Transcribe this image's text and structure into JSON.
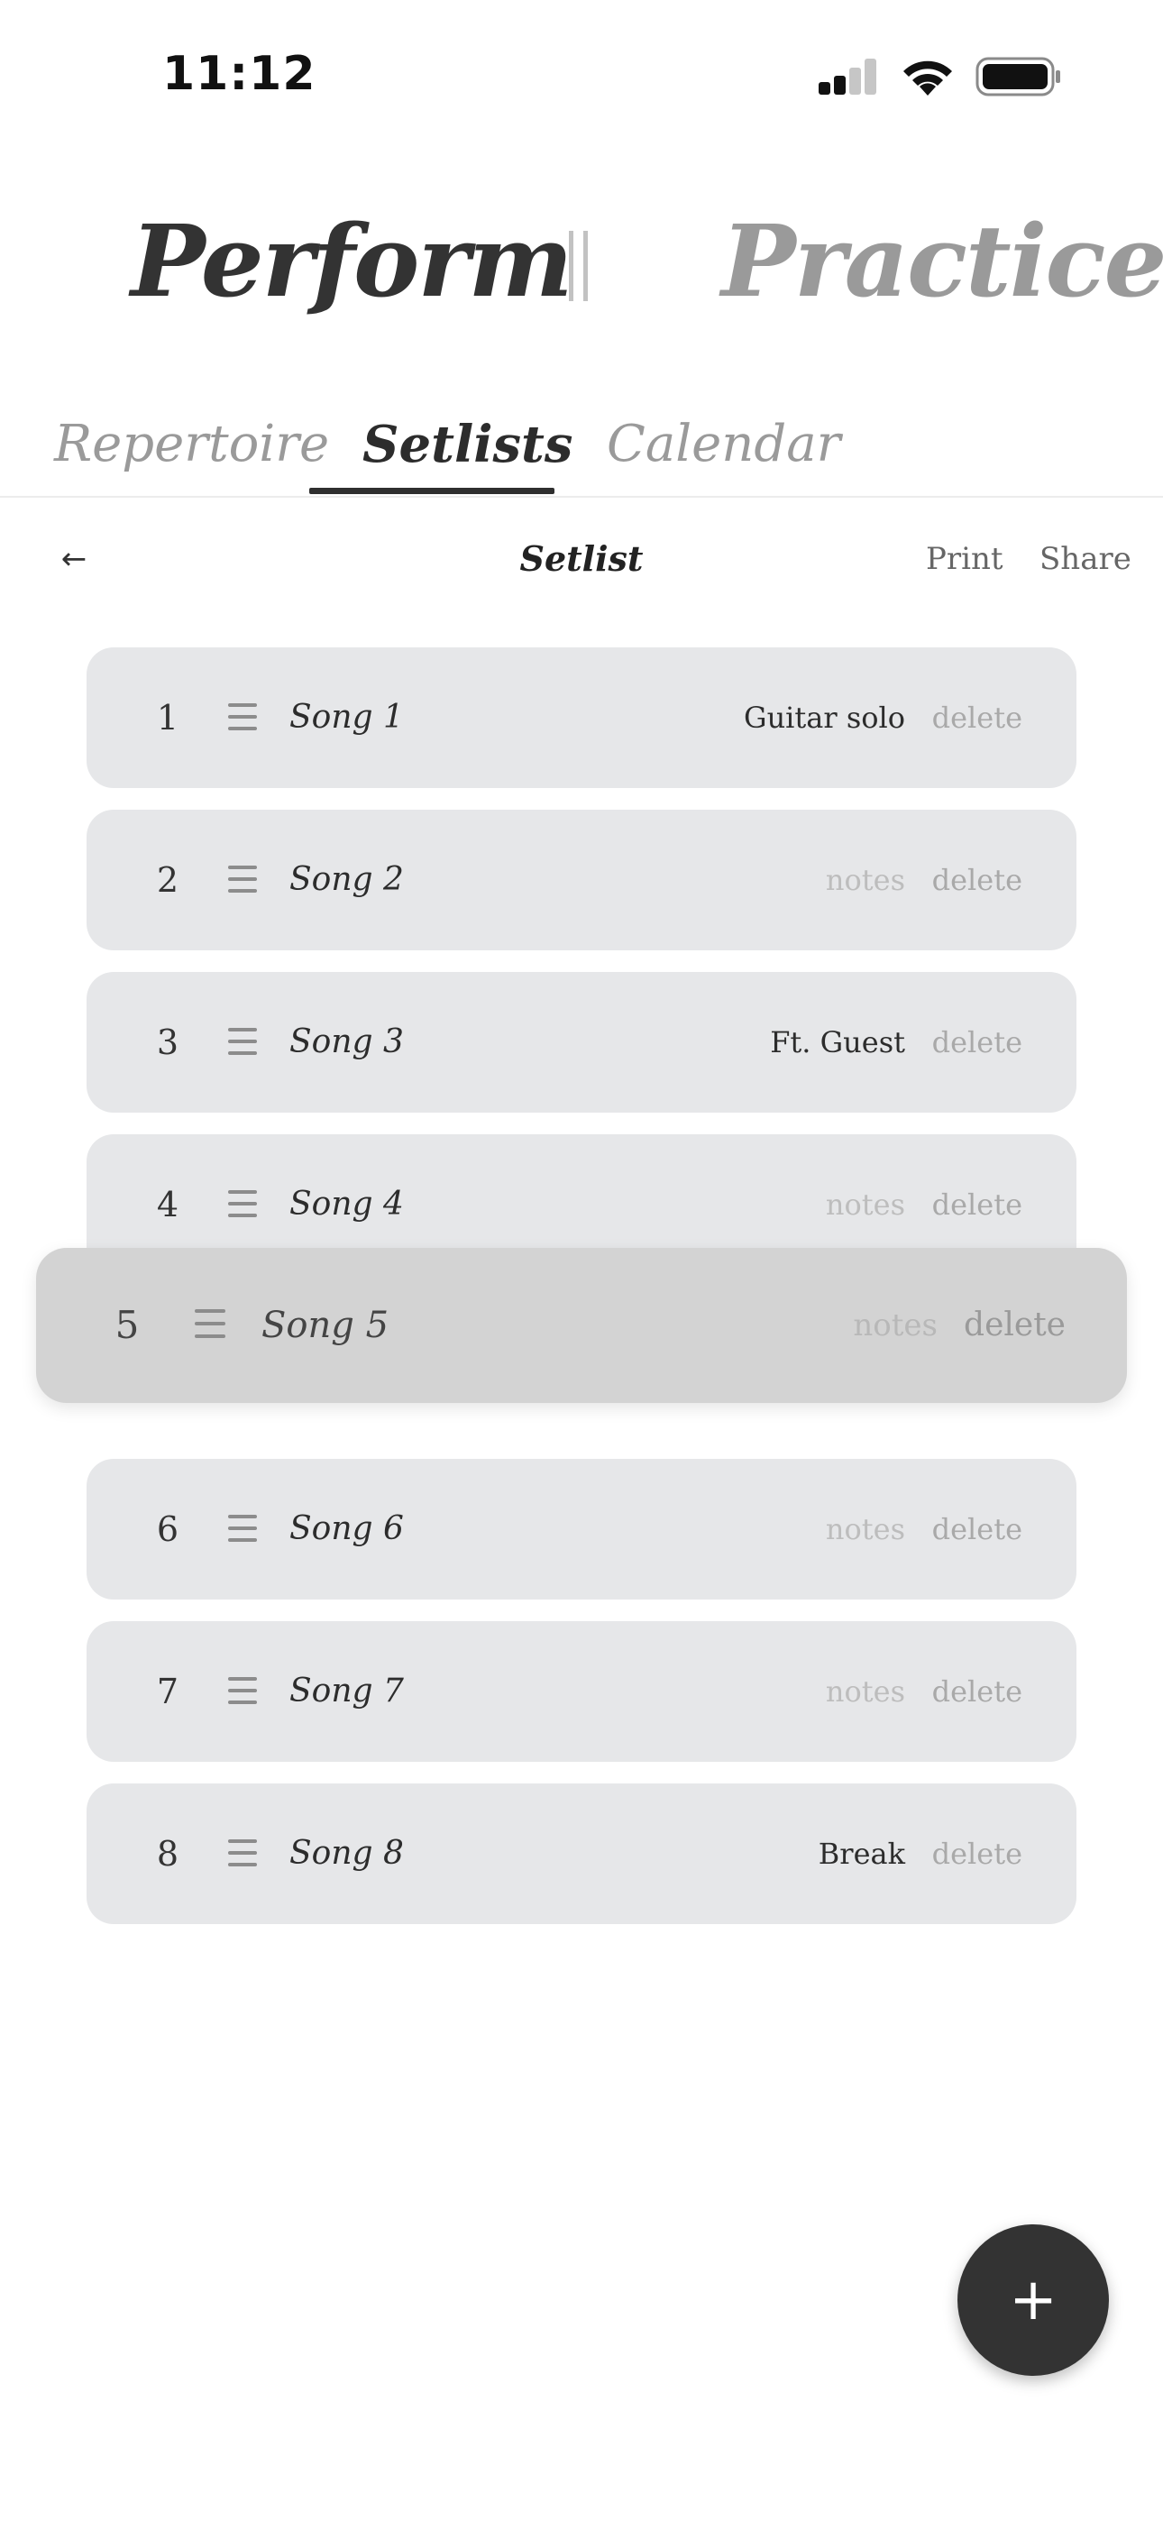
{
  "status_bar": {
    "time": "11:12",
    "icons": [
      "signal-icon",
      "wifi-icon",
      "battery-icon"
    ]
  },
  "modes": {
    "perform": "Perform",
    "practice": "Practice",
    "active": "perform"
  },
  "tabs": [
    {
      "label": "Repertoire",
      "active": false
    },
    {
      "label": "Setlists",
      "active": true
    },
    {
      "label": "Calendar",
      "active": false
    }
  ],
  "toolbar": {
    "back_icon": "arrow-left-icon",
    "back_label": "←",
    "title": "Setlist",
    "print_label": "Print",
    "share_label": "Share"
  },
  "songs": [
    {
      "number": "1",
      "title": "Song 1",
      "note": "Guitar solo",
      "has_note": true,
      "delete_label": "delete"
    },
    {
      "number": "2",
      "title": "Song 2",
      "note": "notes",
      "has_note": false,
      "delete_label": "delete"
    },
    {
      "number": "3",
      "title": "Song 3",
      "note": "Ft. Guest",
      "has_note": true,
      "delete_label": "delete"
    },
    {
      "number": "4",
      "title": "Song 4",
      "note": "notes",
      "has_note": false,
      "delete_label": "delete"
    },
    {
      "number": "5",
      "title": "Song 5",
      "note": "notes",
      "has_note": false,
      "delete_label": "delete",
      "dragging": true
    },
    {
      "number": "6",
      "title": "Song 6",
      "note": "notes",
      "has_note": false,
      "delete_label": "delete"
    },
    {
      "number": "7",
      "title": "Song 7",
      "note": "notes",
      "has_note": false,
      "delete_label": "delete"
    },
    {
      "number": "8",
      "title": "Song 8",
      "note": "Break",
      "has_note": true,
      "delete_label": "delete"
    }
  ],
  "fab": {
    "icon": "plus-icon",
    "label": "+"
  },
  "colors": {
    "row_background": "#e6e7e9",
    "dragging_row_background": "#d3d3d3",
    "active_text": "#333333",
    "inactive_text": "#9a9a9a",
    "fab_background": "#333333"
  }
}
